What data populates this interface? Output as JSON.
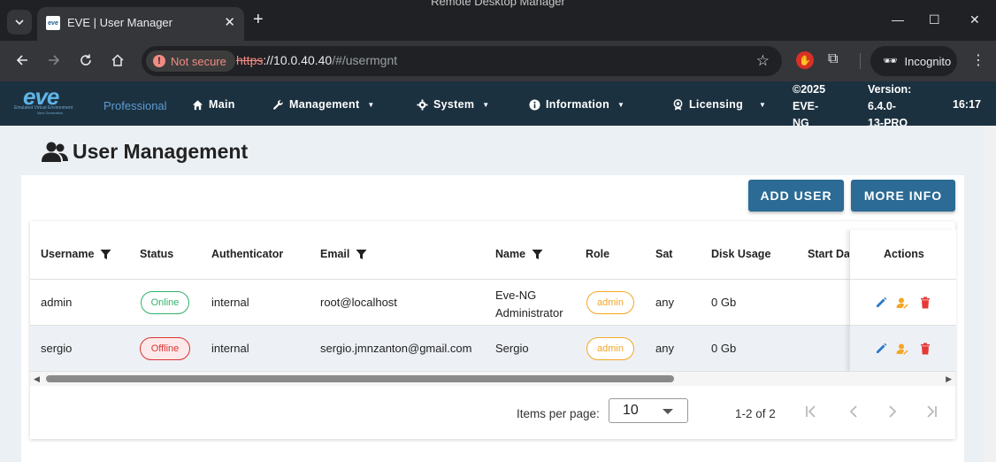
{
  "os": {
    "window_title": "Remote Desktop Manager"
  },
  "browser": {
    "tab": {
      "title": "EVE | User Manager",
      "favicon_text": "eve"
    },
    "new_tab": "+",
    "security_label": "Not secure",
    "url": {
      "protocol": "https",
      "host": "://10.0.40.40",
      "path": "/#/usermgnt"
    },
    "incognito_label": "Incognito",
    "icons": [
      "back-icon",
      "forward-icon",
      "reload-icon",
      "home-icon",
      "star-icon",
      "extension-icon",
      "incognito-icon",
      "menu-icon"
    ]
  },
  "navbar": {
    "logo": {
      "word": "eve",
      "tagline": "Emulated Virtual Environment",
      "tagline2": "Next Generation"
    },
    "edition": "Professional",
    "items": [
      {
        "label": "Main",
        "icon": "home-icon",
        "has_caret": false
      },
      {
        "label": "Management",
        "icon": "wrench-icon",
        "has_caret": true
      },
      {
        "label": "System",
        "icon": "gear-icon",
        "has_caret": true
      },
      {
        "label": "Information",
        "icon": "info-icon",
        "has_caret": true
      },
      {
        "label": "Licensing",
        "icon": "award-icon",
        "has_caret": true
      }
    ],
    "copyright": [
      "©2025",
      "EVE-",
      "NG"
    ],
    "version": [
      "Version:",
      "6.4.0-",
      "13-PRO"
    ],
    "time": "16:17"
  },
  "page": {
    "title": "User Management",
    "title_icon": "users-icon",
    "buttons": {
      "add_user": "ADD USER",
      "more_info": "MORE INFO"
    }
  },
  "table": {
    "columns": [
      {
        "label": "Username",
        "filter": true
      },
      {
        "label": "Status",
        "filter": false
      },
      {
        "label": "Authenticator",
        "filter": false
      },
      {
        "label": "Email",
        "filter": true
      },
      {
        "label": "Name",
        "filter": true
      },
      {
        "label": "Role",
        "filter": false
      },
      {
        "label": "Sat",
        "filter": false
      },
      {
        "label": "Disk Usage",
        "filter": false
      },
      {
        "label": "Start Da",
        "filter": false
      },
      {
        "label": "Actions",
        "filter": false
      }
    ],
    "rows": [
      {
        "username": "admin",
        "status": "Online",
        "authenticator": "internal",
        "email": "root@localhost",
        "name": "Eve-NG Administrator",
        "role": "admin",
        "sat": "any",
        "disk_usage": "0 Gb"
      },
      {
        "username": "sergio",
        "status": "Offline",
        "authenticator": "internal",
        "email": "sergio.jmnzanton@gmail.com",
        "name": "Sergio",
        "role": "admin",
        "sat": "any",
        "disk_usage": "0 Gb"
      }
    ],
    "row_action_icons": [
      "edit-icon",
      "user-manage-icon",
      "delete-icon"
    ]
  },
  "paginator": {
    "label": "Items per page:",
    "page_size": "10",
    "range": "1-2 of 2"
  },
  "colors": {
    "navbar_bg": "#1c3140",
    "button_bg": "#2b6b95",
    "online": "#2fb36b",
    "offline": "#d93535",
    "role_badge": "#f5a623",
    "edit_icon": "#2b78c8",
    "user_icon": "#f5a623",
    "delete_icon": "#e53935"
  }
}
